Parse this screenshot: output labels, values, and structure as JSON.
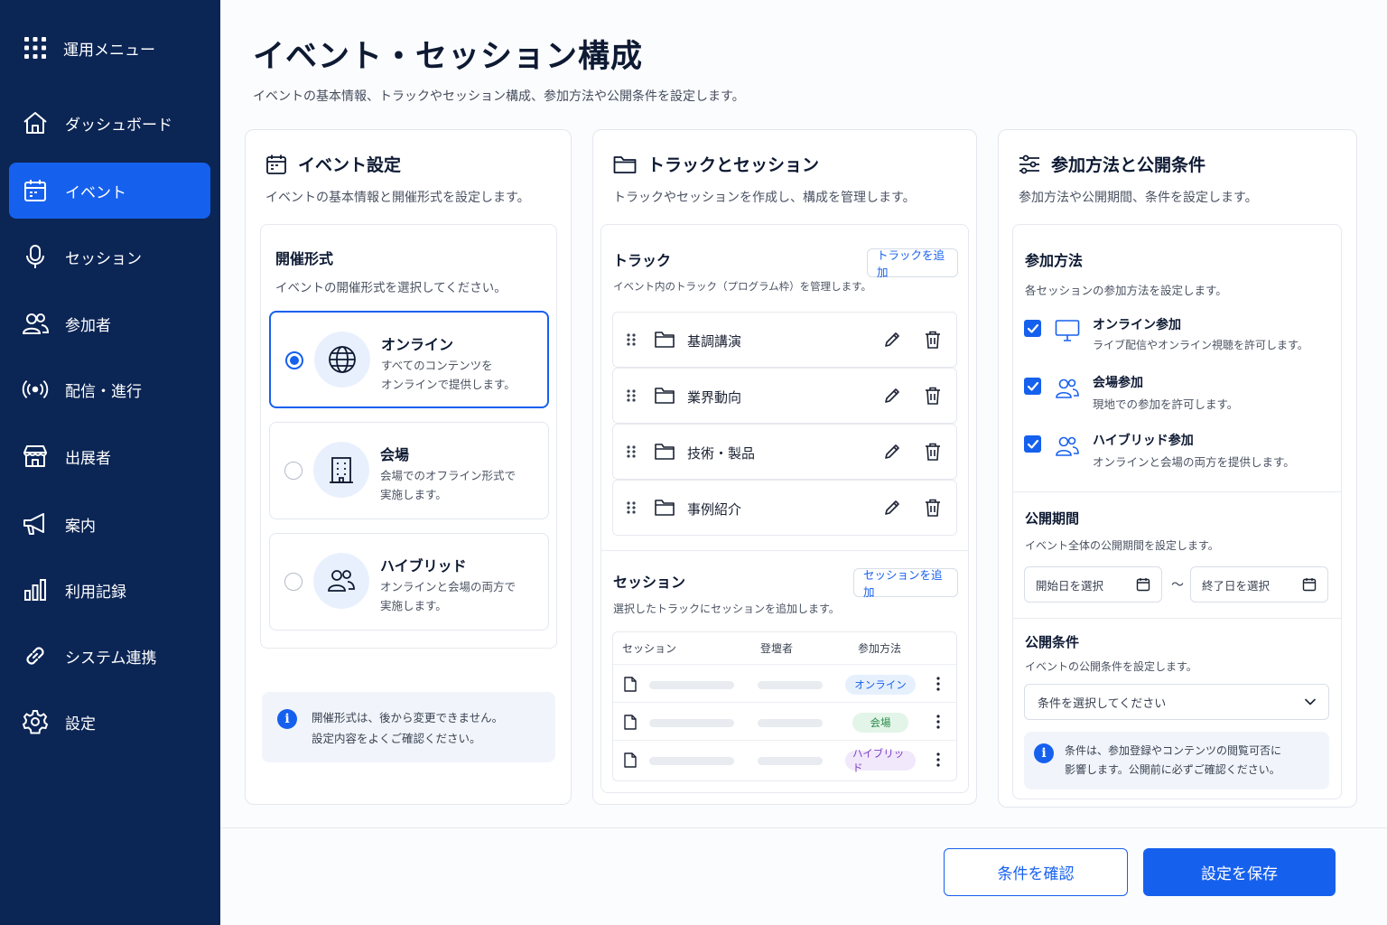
{
  "sidebar": {
    "header": "運用メニュー",
    "items": [
      {
        "label": "ダッシュボード",
        "icon": "home-icon",
        "active": false
      },
      {
        "label": "イベント",
        "icon": "calendar-icon",
        "active": true
      },
      {
        "label": "セッション",
        "icon": "microphone-icon",
        "active": false
      },
      {
        "label": "参加者",
        "icon": "users-icon",
        "active": false
      },
      {
        "label": "配信・進行",
        "icon": "broadcast-icon",
        "active": false
      },
      {
        "label": "出展者",
        "icon": "store-icon",
        "active": false
      },
      {
        "label": "案内",
        "icon": "megaphone-icon",
        "active": false
      },
      {
        "label": "利用記録",
        "icon": "bar-chart-icon",
        "active": false
      },
      {
        "label": "システム連携",
        "icon": "link-icon",
        "active": false
      },
      {
        "label": "設定",
        "icon": "gear-icon",
        "active": false
      }
    ]
  },
  "page": {
    "title": "イベント・セッション構成",
    "description": "イベントの基本情報、トラックやセッション構成、参加方法や公開条件を設定します。"
  },
  "event_settings": {
    "title": "イベント設定",
    "description": "イベントの基本情報と開催形式を設定します。",
    "format_title": "開催形式",
    "format_description": "イベントの開催形式を選択してください。",
    "options": [
      {
        "title": "オンライン",
        "desc1": "すべてのコンテンツを",
        "desc2": "オンラインで提供します。",
        "selected": true
      },
      {
        "title": "会場",
        "desc1": "会場でのオフライン形式で",
        "desc2": "実施します。",
        "selected": false
      },
      {
        "title": "ハイブリッド",
        "desc1": "オンラインと会場の両方で",
        "desc2": "実施します。",
        "selected": false
      }
    ],
    "note_line1": "開催形式は、後から変更できません。",
    "note_line2": "設定内容をよくご確認ください。"
  },
  "tracks_sessions": {
    "title": "トラックとセッション",
    "description": "トラックやセッションを作成し、構成を管理します。",
    "track_title": "トラック",
    "track_description": "イベント内のトラック（プログラム枠）を管理します。",
    "add_track_label": "トラックを追加",
    "tracks": [
      "基調講演",
      "業界動向",
      "技術・製品",
      "事例紹介"
    ],
    "session_title": "セッション",
    "session_description": "選択したトラックにセッションを追加します。",
    "add_session_label": "セッションを追加",
    "columns": [
      "セッション",
      "登壇者",
      "参加方法"
    ],
    "rows": [
      {
        "method": "オンライン"
      },
      {
        "method": "会場"
      },
      {
        "method": "ハイブリッド"
      }
    ]
  },
  "participation": {
    "title": "参加方法と公開条件",
    "description": "参加方法や公開期間、条件を設定します。",
    "method_title": "参加方法",
    "method_description": "各セッションの参加方法を設定します。",
    "methods": [
      {
        "title": "オンライン参加",
        "desc": "ライブ配信やオンライン視聴を許可します。",
        "checked": true
      },
      {
        "title": "会場参加",
        "desc": "現地での参加を許可します。",
        "checked": true
      },
      {
        "title": "ハイブリッド参加",
        "desc": "オンラインと会場の両方を提供します。",
        "checked": true
      }
    ],
    "period_title": "公開期間",
    "period_description": "イベント全体の公開期間を設定します。",
    "start_placeholder": "開始日を選択",
    "separator": "〜",
    "end_placeholder": "終了日を選択",
    "condition_title": "公開条件",
    "condition_description": "イベントの公開条件を設定します。",
    "condition_placeholder": "条件を選択してください",
    "note_line1": "条件は、参加登録やコンテンツの閲覧可否に",
    "note_line2": "影響します。公開前に必ずご確認ください。"
  },
  "footer": {
    "confirm_label": "条件を確認",
    "save_label": "設定を保存"
  },
  "colors": {
    "sidebar_bg": "#0b2555",
    "accent": "#1660ee",
    "badge_online": "#e6f0fd",
    "badge_venue": "#e3f5e8",
    "badge_hybrid": "#f1e8fb"
  }
}
